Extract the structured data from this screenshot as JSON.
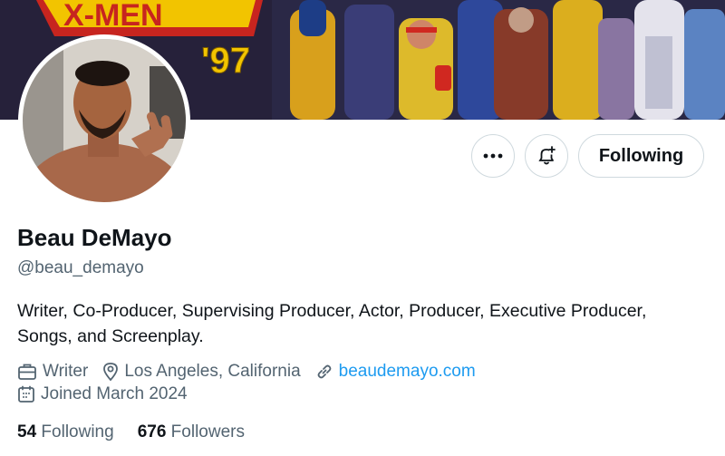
{
  "banner": {
    "logo_text": "X-MEN",
    "year_text": "'97"
  },
  "profile": {
    "display_name": "Beau DeMayo",
    "handle": "@beau_demayo",
    "bio": "Writer, Co-Producer, Supervising Producer, Actor, Producer, Executive Producer, Songs, and Screenplay.",
    "profession": "Writer",
    "location": "Los Angeles, California",
    "website": "beaudemayo.com",
    "joined": "Joined March 2024",
    "following_count": "54",
    "following_label": "Following",
    "followers_count": "676",
    "followers_label": "Followers"
  },
  "actions": {
    "more_label": "•••",
    "following_button": "Following"
  },
  "icons": {
    "more": "more-icon",
    "notify": "bell-plus-icon",
    "profession": "briefcase-icon",
    "location": "location-pin-icon",
    "website": "link-icon",
    "joined": "calendar-icon"
  },
  "colors": {
    "link": "#1d9bf0",
    "secondary_text": "#536471",
    "primary_text": "#0f1419",
    "border": "#cfd9de"
  }
}
